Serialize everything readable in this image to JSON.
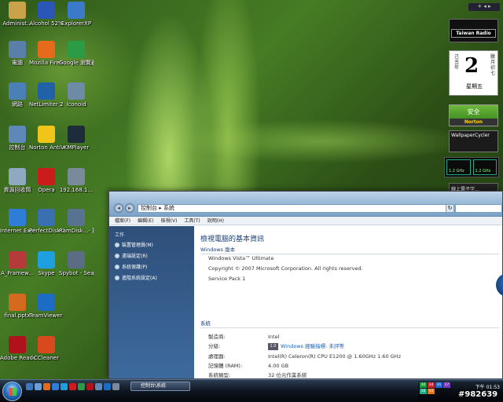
{
  "desktop_icons": [
    {
      "label": "Administ...",
      "icon": "user-folder-icon",
      "color": "#c9a24a"
    },
    {
      "label": "Alcohol 52%",
      "icon": "alcohol-52-icon",
      "color": "#2a56b8"
    },
    {
      "label": "ExplorerXP",
      "icon": "explorerxp-icon",
      "color": "#3b79c9"
    },
    {
      "label": "電腦",
      "icon": "computer-icon",
      "color": "#5a7fa8"
    },
    {
      "label": "Mozilla Firefox",
      "icon": "firefox-icon",
      "color": "#e56a1c"
    },
    {
      "label": "Google 瀏覽器",
      "icon": "chrome-icon",
      "color": "#2c9b45"
    },
    {
      "label": "網路",
      "icon": "network-icon",
      "color": "#4a7fb8"
    },
    {
      "label": "NetLimiter 2 Pro",
      "icon": "netlimiter-icon",
      "color": "#2161a8"
    },
    {
      "label": "Iconoid",
      "icon": "iconoid-icon",
      "color": "#6f8aa4"
    },
    {
      "label": "控制台",
      "icon": "control-panel-icon",
      "color": "#5d88b7"
    },
    {
      "label": "Norton AntiVirus",
      "icon": "norton-antivirus-icon",
      "color": "#f0c419"
    },
    {
      "label": "KMPlayer",
      "icon": "kmplayer-icon",
      "color": "#1d2b3a"
    },
    {
      "label": "資源回收筒",
      "icon": "recycle-bin-icon",
      "color": "#8fa9c0"
    },
    {
      "label": "Opera",
      "icon": "opera-icon",
      "color": "#cc1b1b"
    },
    {
      "label": "192.168.1...",
      "icon": "network-drive-icon",
      "color": "#7a8a9a"
    },
    {
      "label": "Internet Explorer",
      "icon": "internet-explorer-icon",
      "color": "#2f7dd6"
    },
    {
      "label": "PerfectDisk 2008",
      "icon": "perfectdisk-icon",
      "color": "#3a6fb0"
    },
    {
      "label": "RamDisk...- 捷徑",
      "icon": "ramdisk-icon",
      "color": "#587390"
    },
    {
      "label": "A_Framew...",
      "icon": "document-icon",
      "color": "#b73a3a"
    },
    {
      "label": "Skype",
      "icon": "skype-icon",
      "color": "#1ea0e0"
    },
    {
      "label": "Spybot - Search ...",
      "icon": "spybot-icon",
      "color": "#5b6d82"
    },
    {
      "label": "final.pptx",
      "icon": "powerpoint-icon",
      "color": "#d36a1f"
    },
    {
      "label": "TeamViewer 4",
      "icon": "teamviewer-icon",
      "color": "#1c6bc4"
    },
    {
      "label": "Adobe Reader 9",
      "icon": "adobe-reader-icon",
      "color": "#b0121b"
    },
    {
      "label": "CCleaner",
      "icon": "ccleaner-icon",
      "color": "#d9491d"
    }
  ],
  "gadgets": {
    "radio_title": "Taiwan Radio",
    "calendar": {
      "day": "2",
      "weekday": "星期五",
      "year_label": "二〇〇九年",
      "month_label": "一月",
      "lunar_left": "己丑年",
      "lunar_right": "臘月初七"
    },
    "norton": {
      "status": "安全",
      "brand": "Norton"
    },
    "wallpaper": {
      "title": "WallpaperCycler"
    },
    "cpu": {
      "core1": "1.2 GHz",
      "core2": "1.2 GHz"
    },
    "tv": {
      "label": "線上電子字..."
    }
  },
  "window": {
    "address": "控制台 ▸ 系統",
    "menu": [
      "檔案(F)",
      "編輯(E)",
      "檢視(V)",
      "工具(T)",
      "說明(H)"
    ],
    "side_title": "工作",
    "side_tasks": [
      "裝置管理員(M)",
      "遠端設定(R)",
      "系統保護(P)",
      "進階系統設定(A)"
    ],
    "page_title": "檢視電腦的基本資訊",
    "edition_header": "Windows 版本",
    "edition": "Windows Vista™ Ultimate",
    "copyright": "Copyright © 2007 Microsoft Corporation.  All rights reserved.",
    "service_pack": "Service Pack 1",
    "system_header": "系統",
    "rows": [
      {
        "key": "製造商:",
        "value": "Intel"
      },
      {
        "key": "分級:",
        "value": "Windows 經驗指標: 未評等"
      },
      {
        "key": "處理器:",
        "value": "Intel(R) Celeron(R) CPU        E1200  @ 1.60GHz   1.60 GHz"
      },
      {
        "key": "記憶體 (RAM):",
        "value": "4.00 GB"
      },
      {
        "key": "系統類型:",
        "value": "32 位元作業系統"
      }
    ],
    "rating_badge": "1.0"
  },
  "taskbar": {
    "task_button": "控制台\\系統",
    "clock": "下午 01:53",
    "tray_numbers": [
      "30",
      "34",
      "31",
      "17",
      "16",
      "15"
    ],
    "watermark": "#982639"
  }
}
